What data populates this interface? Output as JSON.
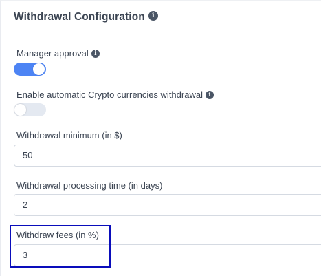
{
  "section": {
    "title": "Withdrawal Configuration",
    "title_icon": "info-icon"
  },
  "fields": {
    "manager_approval": {
      "label": "Manager approval",
      "icon": "info-icon",
      "enabled": true
    },
    "auto_crypto_withdrawal": {
      "label": "Enable automatic Crypto currencies withdrawal",
      "icon": "info-icon",
      "enabled": false
    },
    "withdrawal_minimum": {
      "label": "Withdrawal minimum (in $)",
      "value": "50"
    },
    "processing_time": {
      "label": "Withdrawal processing time (in days)",
      "value": "2"
    },
    "withdraw_fees": {
      "label": "Withdraw fees (in %)",
      "value": "3",
      "highlighted": true
    }
  },
  "colors": {
    "toggle_on": "#4d84f4",
    "toggle_off": "#e4e9f1",
    "text": "#3b4452",
    "highlight": "#0a0dbb"
  }
}
